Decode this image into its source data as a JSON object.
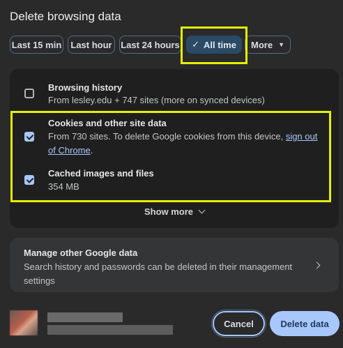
{
  "dialog": {
    "title": "Delete browsing data"
  },
  "time_range": {
    "chips": [
      {
        "label": "Last 15 min"
      },
      {
        "label": "Last hour"
      },
      {
        "label": "Last 24 hours"
      },
      {
        "label": "All time",
        "selected": true
      },
      {
        "label": "More"
      }
    ]
  },
  "options": [
    {
      "title": "Browsing history",
      "description": "From lesley.edu + 747 sites (more on synced devices)",
      "checked": false
    },
    {
      "title": "Cookies and other site data",
      "description": "From 730 sites. To delete Google cookies from this device, ",
      "link": "sign out of Chrome",
      "after_link": ".",
      "checked": true
    },
    {
      "title": "Cached images and files",
      "description": "354 MB",
      "checked": true
    }
  ],
  "show_more": "Show more",
  "manage": {
    "title": "Manage other Google data",
    "description": "Search history and passwords can be deleted in their management settings"
  },
  "footer": {
    "cancel_label": "Cancel",
    "delete_label": "Delete data"
  },
  "colors": {
    "accent": "#a8c7fa",
    "highlight": "#e4f000",
    "selected_chip": "#2b4a66"
  }
}
